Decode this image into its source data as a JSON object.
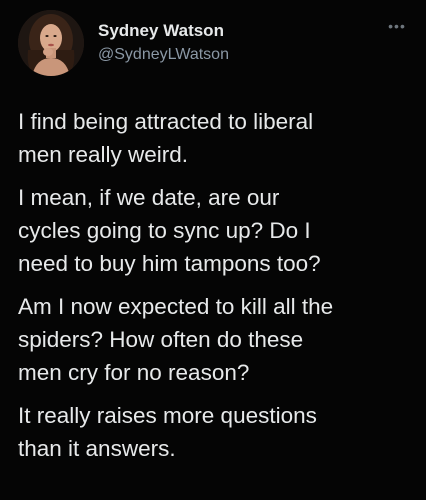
{
  "author": {
    "display_name": "Sydney Watson",
    "handle": "@SydneyLWatson",
    "avatar_icon": "profile-photo"
  },
  "more_icon": "ellipsis-icon",
  "more_glyph": "•••",
  "paragraphs": [
    "I find being attracted to liberal\nmen really weird.",
    "I mean, if we date, are our\ncycles going to sync up? Do I\nneed to buy him tampons too?",
    "Am I now expected to kill all the\nspiders? How often do these\nmen cry for no reason?",
    "It really raises more questions\nthan it answers."
  ],
  "colors": {
    "background": "#050505",
    "text": "#e7e9ea",
    "secondary_text": "#8b98a5"
  }
}
